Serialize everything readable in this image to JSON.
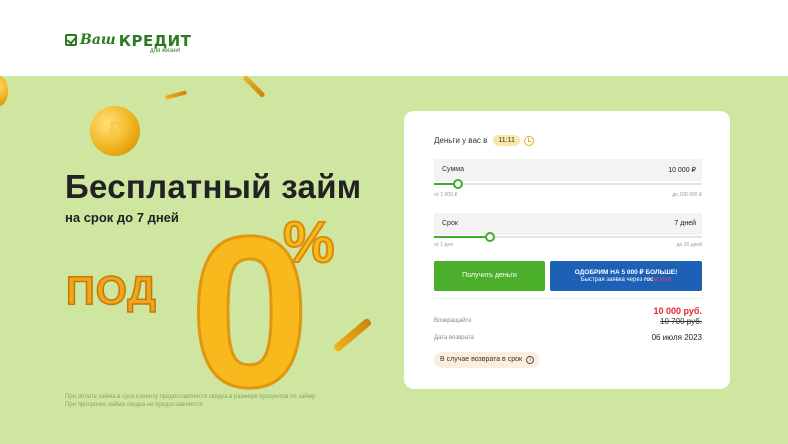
{
  "logo": {
    "part1": "Ваш",
    "part2": "КРЕДИТ",
    "tagline": "для жизни!"
  },
  "hero": {
    "title": "Бесплатный займ",
    "subtitle": "на срок до 7 дней",
    "pod": "ПОД",
    "zero": "0",
    "percent": "%",
    "coin_symbol": "₽",
    "disclaimer_line1": "При оплате займа в срок клиенту предоставляется скидка в размере процентов по займу.",
    "disclaimer_line2": "При просрочке займа скидка не предоставляется"
  },
  "form": {
    "money_label": "Деньги у вас в",
    "money_time": "11:11",
    "sum": {
      "label": "Сумма",
      "value": "10 000 ₽",
      "min": "от 1 000 ₽",
      "max": "до 100 000 ₽",
      "fraction": 0.09
    },
    "term": {
      "label": "Срок",
      "value": "7 дней",
      "min": "от 1 дня",
      "max": "до 30 дней",
      "fraction": 0.21
    },
    "get_money_button": "Получить деньги",
    "gos_line1": "ОДОБРИМ НА 5 000 ₽ БОЛЬШЕ!",
    "gos_line2_prefix": "Быстрая заявка через ",
    "gos_line2_gos": "гос",
    "gos_line2_uslugi": "услуги",
    "return_label": "Возвращайте",
    "return_new": "10 000 руб.",
    "return_old": "10 700 руб.",
    "date_label": "Дата возврата",
    "date_value": "06 июля 2023",
    "on_time_badge": "В случае возврата в срок",
    "info_glyph": "i"
  },
  "colors": {
    "brand_green": "#2c7a21",
    "hero_bg": "#cfe6a0",
    "button_green": "#4caf2b",
    "button_blue": "#1c61b6",
    "price_red": "#e8252e",
    "gold": "#f8b91c"
  },
  "icons": {
    "logo": "checkbox-icon",
    "clock": "alarm-clock-icon",
    "info": "info-icon",
    "coin": "ruble-coin-icon"
  }
}
